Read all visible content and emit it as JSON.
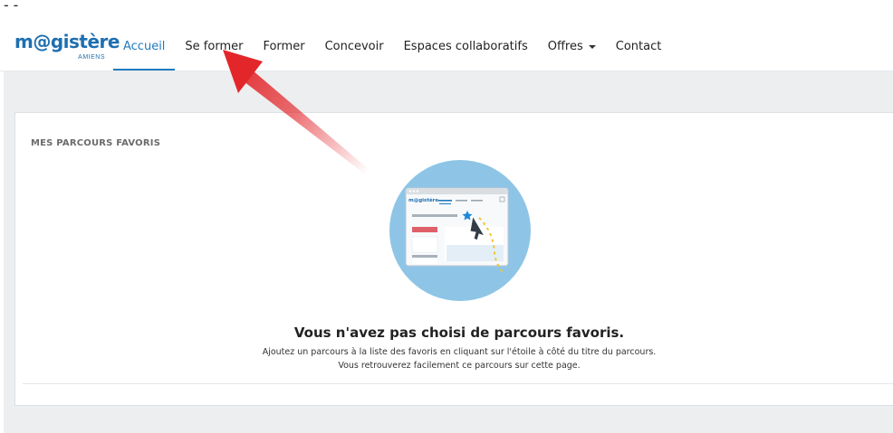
{
  "top_mark": "--",
  "logo": {
    "text": "m@gistère",
    "subtitle": "AMIENS"
  },
  "nav": {
    "items": [
      {
        "label": "Accueil",
        "active": true
      },
      {
        "label": "Se former"
      },
      {
        "label": "Former"
      },
      {
        "label": "Concevoir"
      },
      {
        "label": "Espaces collaboratifs"
      },
      {
        "label": "Offres",
        "dropdown": true
      },
      {
        "label": "Contact"
      }
    ]
  },
  "favorites": {
    "section_title": "MES PARCOURS FAVORIS",
    "illustration_logo": "m@gistère",
    "empty_title": "Vous n'avez pas choisi de parcours favoris.",
    "empty_line1": "Ajoutez un parcours à la liste des favoris en cliquant sur l'étoile à côté du titre du parcours.",
    "empty_line2": "Vous retrouverez facilement ce parcours sur cette page."
  },
  "colors": {
    "brand": "#1e6fb0",
    "active_nav": "#1e7bbf",
    "annotation_arrow": "#e3262a",
    "illustration_circle": "#8ec5e6",
    "star": "#1e88d8"
  },
  "icons": [
    "star-icon",
    "cursor-icon",
    "dropdown-caret-icon",
    "annotation-arrow-icon"
  ]
}
